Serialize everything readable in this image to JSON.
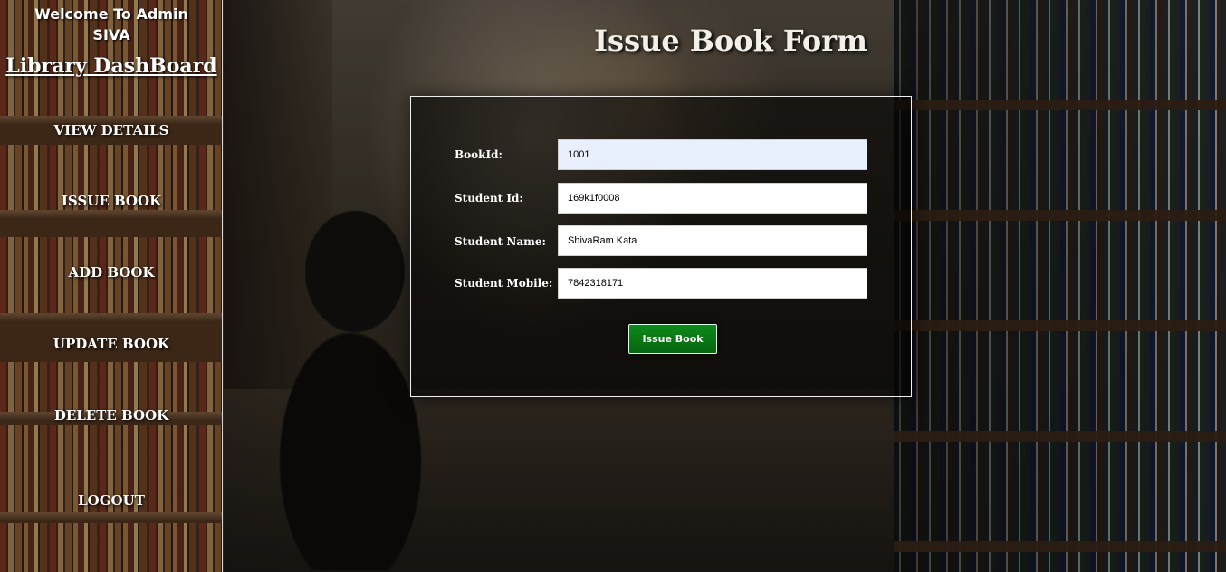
{
  "sidebar": {
    "welcome_line1": "Welcome To Admin",
    "welcome_line2": "SIVA",
    "title": "Library DashBoard",
    "items": [
      {
        "label": "VIEW DETAILS"
      },
      {
        "label": "ISSUE BOOK"
      },
      {
        "label": "ADD BOOK"
      },
      {
        "label": "UPDATE BOOK"
      },
      {
        "label": "DELETE BOOK"
      },
      {
        "label": "LOGOUT"
      }
    ]
  },
  "main": {
    "title": "Issue Book Form"
  },
  "form": {
    "fields": [
      {
        "label": "BookId:",
        "value": "1001"
      },
      {
        "label": "Student Id:",
        "value": "169k1f0008"
      },
      {
        "label": "Student Name:",
        "value": "ShivaRam Kata"
      },
      {
        "label": "Student Mobile:",
        "value": "7842318171"
      }
    ],
    "submit_label": "Issue Book"
  },
  "colors": {
    "button_green": "#0a7a15",
    "autofill_blue": "#e8f0fe"
  }
}
